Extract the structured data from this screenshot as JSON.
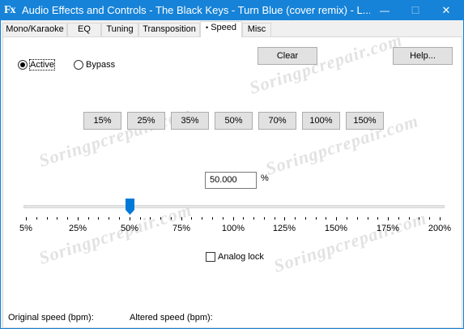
{
  "window": {
    "icon_text": "Fx",
    "title": "Audio Effects and Controls - The Black Keys - Turn Blue (cover remix) - L...",
    "minimize_glyph": "—",
    "maximize_glyph": "☐",
    "close_glyph": "✕"
  },
  "tabs": [
    {
      "label": "Mono/Karaoke",
      "active": false
    },
    {
      "label": "EQ",
      "active": false
    },
    {
      "label": "Tuning",
      "active": false
    },
    {
      "label": "Transposition",
      "active": false
    },
    {
      "label": "Speed",
      "active": true
    },
    {
      "label": "Misc",
      "active": false
    }
  ],
  "active_tab_dot": "•",
  "mode": {
    "active_label": "Active",
    "bypass_label": "Bypass",
    "selected": "Active"
  },
  "buttons": {
    "clear": "Clear",
    "help": "Help..."
  },
  "presets": [
    "15%",
    "25%",
    "35%",
    "50%",
    "70%",
    "100%",
    "150%"
  ],
  "speed": {
    "value": "50.000",
    "unit": "%",
    "slider_value_percent": 50,
    "slider_min_percent": 5,
    "slider_max_percent": 200
  },
  "scale": [
    "5%",
    "25%",
    "50%",
    "75%",
    "100%",
    "125%",
    "150%",
    "175%",
    "200%"
  ],
  "analog_lock": {
    "label": "Analog lock",
    "checked": false
  },
  "footer": {
    "original_label": "Original speed (bpm):",
    "altered_label": "Altered speed (bpm):"
  },
  "watermark_text": "Soringpcrepair.com",
  "colors": {
    "titlebar": "#1683d8",
    "thumb": "#0078d7"
  }
}
